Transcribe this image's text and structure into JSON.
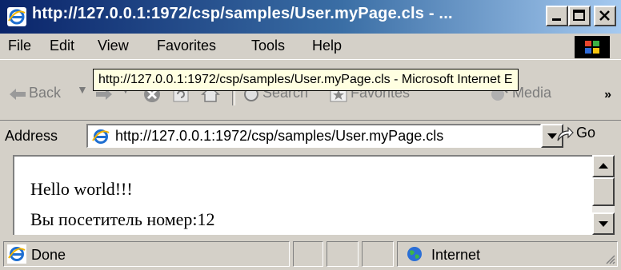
{
  "window": {
    "title": "http://127.0.0.1:1972/csp/samples/User.myPage.cls - ...",
    "controls": {
      "minimize": "_",
      "maximize": "□",
      "close": "X"
    }
  },
  "menu": {
    "items": [
      {
        "label": "File"
      },
      {
        "label": "Edit"
      },
      {
        "label": "View"
      },
      {
        "label": "Favorites"
      },
      {
        "label": "Tools"
      },
      {
        "label": "Help"
      }
    ]
  },
  "tooltip": {
    "text": "http://127.0.0.1:1972/csp/samples/User.myPage.cls - Microsoft Internet E"
  },
  "toolbar": {
    "back_label": "Back",
    "search_label": "Search",
    "favorites_label": "Favorites",
    "media_label": "Media",
    "overflow_label": "»"
  },
  "address": {
    "label": "Address",
    "url": "http://127.0.0.1:1972/csp/samples/User.myPage.cls",
    "go_label": "Go"
  },
  "content": {
    "line1": "Hello world!!!",
    "line2": "Вы посетитель номер:12"
  },
  "status": {
    "text": "Done",
    "zone": "Internet"
  },
  "colors": {
    "title_start": "#0a246a",
    "title_end": "#a6caf0",
    "chrome": "#d4d0c8",
    "tooltip_bg": "#ffffe1"
  }
}
